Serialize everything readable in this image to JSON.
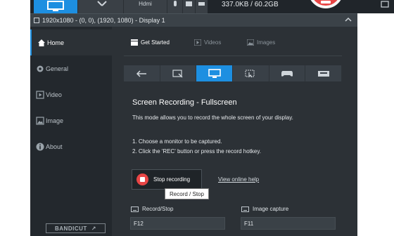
{
  "topbar": {
    "hdmi_label": "Hdmi",
    "stats": "337.0KB / 60.2GB"
  },
  "display_bar": {
    "text": "1920x1080 - (0, 0), (1920, 1080) - Display 1"
  },
  "sidebar": {
    "items": [
      {
        "label": "Home",
        "icon": "home-icon"
      },
      {
        "label": "General",
        "icon": "gear-icon"
      },
      {
        "label": "Video",
        "icon": "video-icon"
      },
      {
        "label": "Image",
        "icon": "image-icon"
      },
      {
        "label": "About",
        "icon": "info-icon"
      }
    ],
    "logo": "BANDICUT"
  },
  "tabs": [
    {
      "label": "Get Started",
      "icon": "clapper-icon"
    },
    {
      "label": "Videos",
      "icon": "play-icon"
    },
    {
      "label": "Images",
      "icon": "picture-icon"
    }
  ],
  "modes": [
    {
      "icon": "back-arrow-icon"
    },
    {
      "icon": "rectangle-select-icon"
    },
    {
      "icon": "monitor-icon"
    },
    {
      "icon": "around-mouse-icon"
    },
    {
      "icon": "gamepad-icon"
    },
    {
      "icon": "hdmi-device-icon"
    }
  ],
  "content": {
    "title": "Screen Recording - Fullscreen",
    "description": "This mode allows you to record the whole screen of your display.",
    "step1": "1. Choose a monitor to be captured.",
    "step2": "2. Click the 'REC' button or press the record hotkey.",
    "stop_button": "Stop recording",
    "tooltip": "Record / Stop",
    "help_link": "View online help",
    "hotkeys": [
      {
        "label": "Record/Stop",
        "value": "F12"
      },
      {
        "label": "Image capture",
        "value": "F11"
      }
    ]
  },
  "colors": {
    "accent": "#1d8fe1",
    "record": "#e84545",
    "background": "#2c3136",
    "sidebar": "#23282d"
  }
}
